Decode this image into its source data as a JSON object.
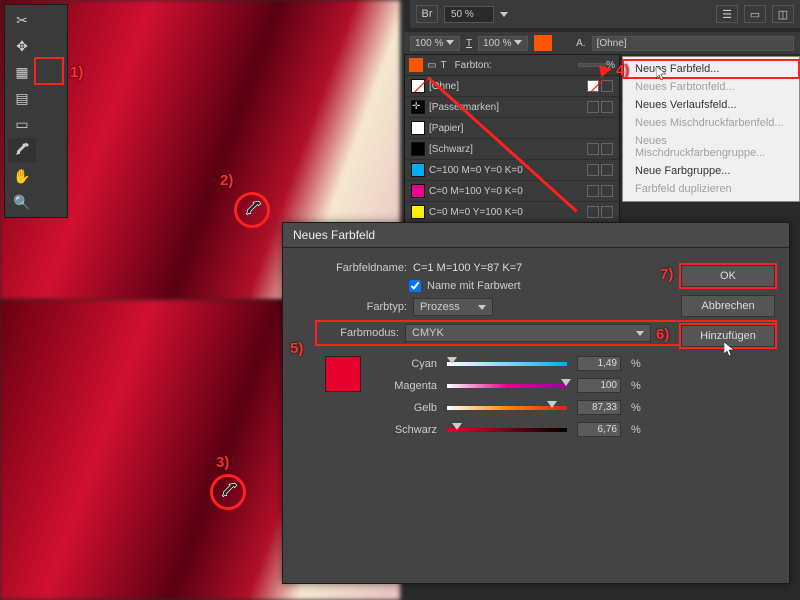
{
  "topbar": {
    "bridge": "Br",
    "zoom": "50 %"
  },
  "topbar2": {
    "scale1": "100 %",
    "scale2": "100 %",
    "farbton": "Farbton:",
    "pct": "%",
    "charstyle": "[Ohne]"
  },
  "swatches": {
    "items": [
      {
        "name": "[Ohne]",
        "chip": "none"
      },
      {
        "name": "[Passermarken]",
        "chip": "reg"
      },
      {
        "name": "[Papier]",
        "chip": "#ffffff"
      },
      {
        "name": "[Schwarz]",
        "chip": "#000000"
      },
      {
        "name": "C=100 M=0 Y=0 K=0",
        "chip": "cyan"
      },
      {
        "name": "C=0 M=100 Y=0 K=0",
        "chip": "magenta"
      },
      {
        "name": "C=0 M=0 Y=100 K=0",
        "chip": "yellow"
      }
    ]
  },
  "flyout": {
    "items": [
      {
        "label": "Neues Farbfeld...",
        "enabled": true,
        "highlight": true
      },
      {
        "label": "Neues Farbtonfeld...",
        "enabled": false
      },
      {
        "label": "Neues Verlaufsfeld...",
        "enabled": true
      },
      {
        "label": "Neues Mischdruckfarbenfeld...",
        "enabled": false
      },
      {
        "label": "Neues Mischdruckfarbengruppe...",
        "enabled": false
      },
      {
        "label": "Neue Farbgruppe...",
        "enabled": true
      },
      {
        "label": "Farbfeld duplizieren",
        "enabled": false
      }
    ]
  },
  "dialog": {
    "title": "Neues Farbfeld",
    "name_lbl": "Farbfeldname:",
    "name_val": "C=1 M=100 Y=87 K=7",
    "chk_lbl": "Name mit Farbwert",
    "type_lbl": "Farbtyp:",
    "type_val": "Prozess",
    "mode_lbl": "Farbmodus:",
    "mode_val": "CMYK",
    "sliders": {
      "cyan": {
        "label": "Cyan",
        "value": "1,49",
        "pct": "%"
      },
      "magenta": {
        "label": "Magenta",
        "value": "100",
        "pct": "%"
      },
      "yellow": {
        "label": "Gelb",
        "value": "87,33",
        "pct": "%"
      },
      "black": {
        "label": "Schwarz",
        "value": "6,76",
        "pct": "%"
      }
    },
    "buttons": {
      "ok": "OK",
      "cancel": "Abbrechen",
      "add": "Hinzufügen"
    }
  },
  "anno": {
    "n1": "1)",
    "n2": "2)",
    "n3": "3)",
    "n4": "4)",
    "n5": "5)",
    "n6": "6)",
    "n7": "7)"
  }
}
